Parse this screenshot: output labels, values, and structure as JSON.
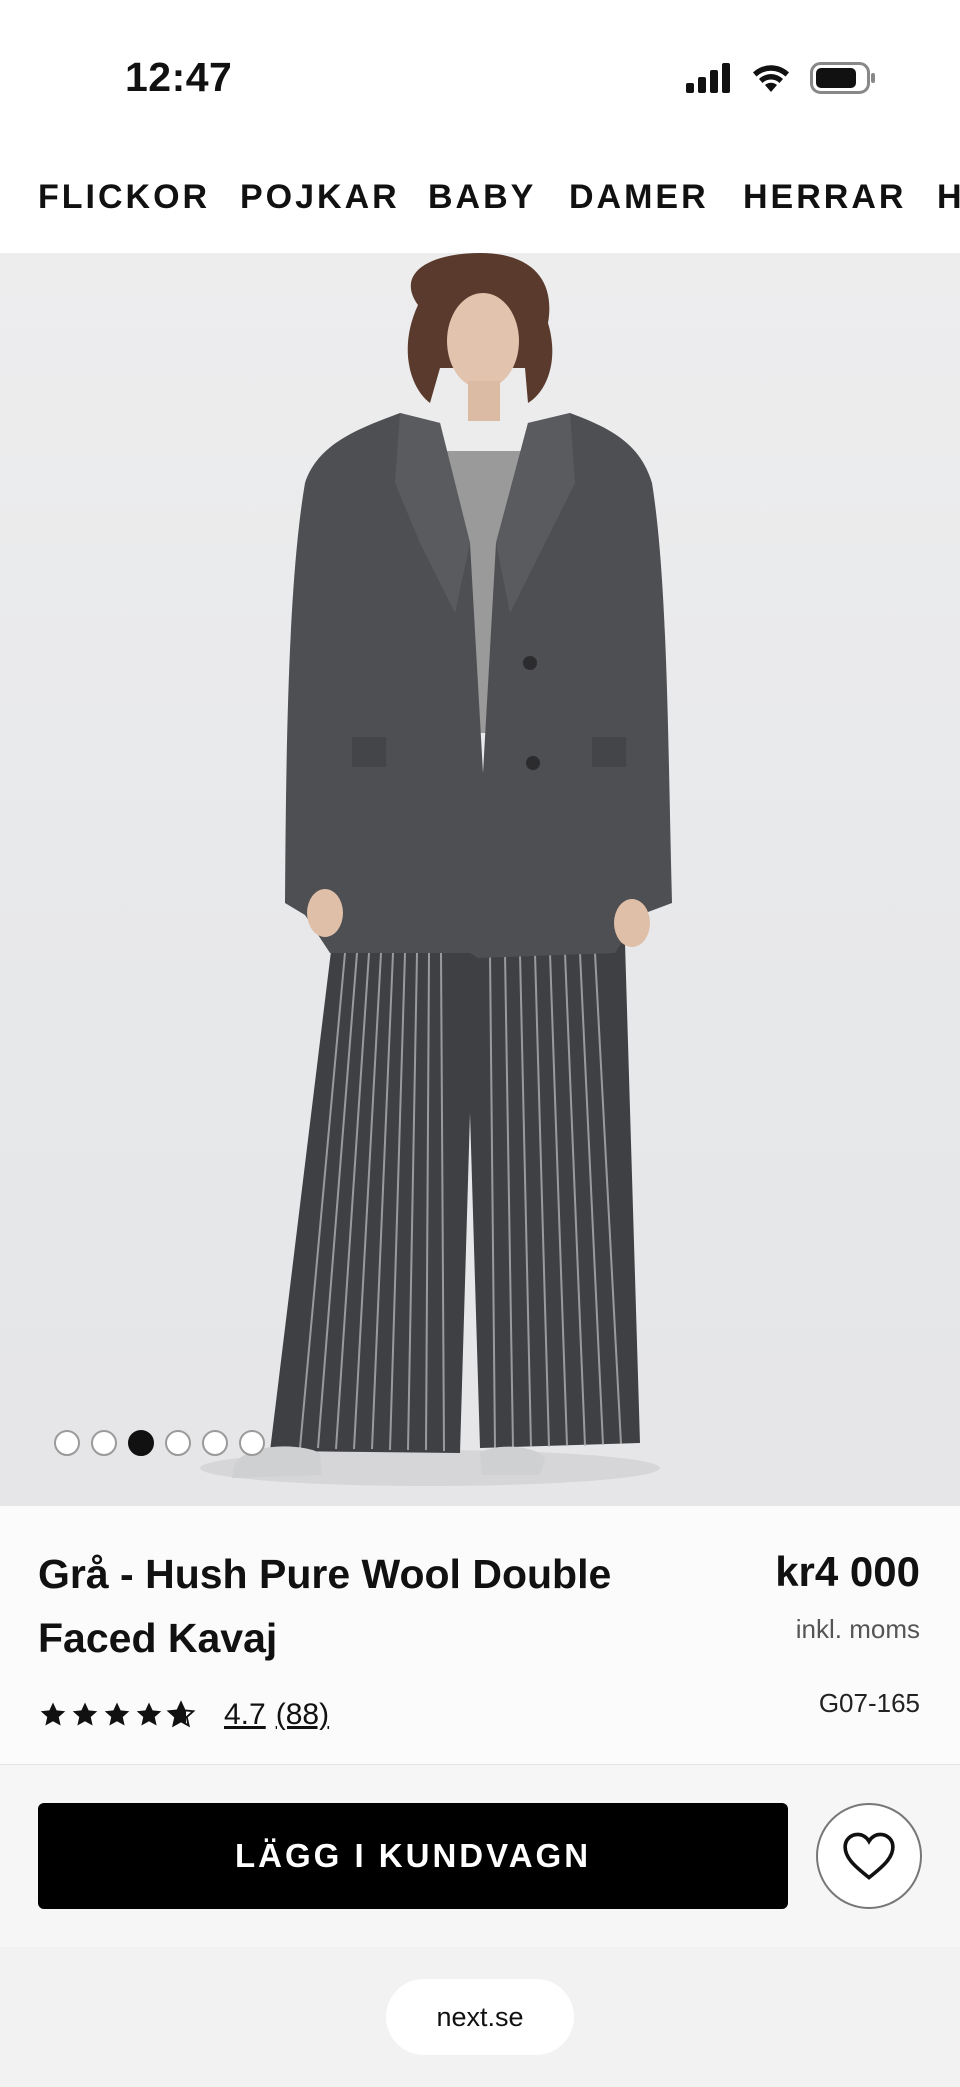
{
  "status_bar": {
    "time": "12:47",
    "icons": [
      "signal-icon",
      "wifi-icon",
      "battery-icon"
    ]
  },
  "category_nav": {
    "items": [
      "FLICKOR",
      "POJKAR",
      "BABY",
      "DAMER",
      "HERRAR",
      "H"
    ]
  },
  "gallery": {
    "image_subject": "woman-in-grey-blazer-and-pinstripe-trousers",
    "dot_count": 6,
    "active_index": 2
  },
  "product": {
    "title": "Grå - Hush Pure Wool Double Faced Kavaj",
    "price": "kr4 000",
    "vat_note": "inkl. moms",
    "sku": "G07-165",
    "rating_value": "4.7",
    "rating_count": "(88)",
    "rating_stars": 4.7
  },
  "actions": {
    "add_to_cart_label": "LÄGG I KUNDVAGN"
  },
  "browser": {
    "url": "next.se"
  },
  "colors": {
    "button_bg": "#000000",
    "text": "#111111",
    "hero_bg": "#ebebec"
  }
}
